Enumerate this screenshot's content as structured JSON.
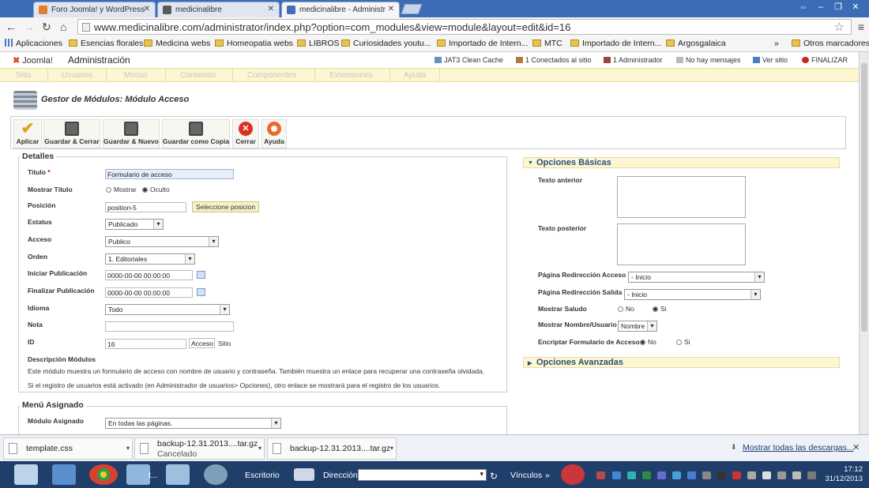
{
  "browser": {
    "tabs": [
      {
        "label": "Foro Joomla! y WordPress"
      },
      {
        "label": "medicinalibre"
      },
      {
        "label": "medicinalibre - Administr"
      }
    ],
    "url": "www.medicinalibre.com/administrator/index.php?option=com_modules&view=module&layout=edit&id=16",
    "bookmarks": [
      "Aplicaciones",
      "Esencias florales",
      "Medicina webs",
      "Homeopatia webs",
      "LIBROS",
      "Curiosidades youtu...",
      "Importado de Intern...",
      "MTC",
      "Importado de Intern...",
      "Argosgalaica"
    ],
    "bookmarks_overflow": "»",
    "other_bookmarks": "Otros marcadores"
  },
  "joomla": {
    "logo": "Joomla!",
    "admin_title": "Administración",
    "status": [
      "JAT3 Clean Cache",
      "1 Conectados al sitio",
      "1 Administrador",
      "No hay mensajes",
      "Ver sitio",
      "FINALIZAR"
    ],
    "menu": [
      "Sitio",
      "Usuarios",
      "Menús",
      "Contenido",
      "Componentes",
      "Extensiones",
      "Ayuda"
    ],
    "page_title": "Gestor de Módulos: Módulo Acceso",
    "toolbar": [
      "Aplicar",
      "Guardar & Cerrar",
      "Guardar & Nuevo",
      "Guardar como Copia",
      "Cerrar",
      "Ayuda"
    ],
    "details": {
      "legend": "Detalles",
      "titulo_label": "Titulo",
      "required_mark": "*",
      "titulo_value": "Formulario de acceso",
      "mostrar_titulo_label": "Mostrar Título",
      "mostrar": "Mostrar",
      "oculto": "Oculto",
      "posicion_label": "Posición",
      "posicion_value": "position-5",
      "posicion_button": "Seleccione posicion",
      "estatus_label": "Estatus",
      "estatus_value": "Publicado",
      "acceso_label": "Acceso",
      "acceso_value": "Publico",
      "orden_label": "Orden",
      "orden_value": "1. Editoriales",
      "iniciar_label": "Iniciar Publicación",
      "iniciar_value": "0000-00-00 00:00:00",
      "finalizar_label": "Finalizar Publicación",
      "finalizar_value": "0000-00-00 00:00:00",
      "idioma_label": "Idioma",
      "idioma_value": "Todo",
      "nota_label": "Nota",
      "nota_value": "",
      "id_label": "ID",
      "id_value": "16",
      "id_acceso": "Acceso",
      "id_sitio": "Sitio",
      "desc_label": "Descripción Módulos",
      "desc_1": "Este módulo muestra un formulario de acceso con nombre de usuario y contraseña. También muestra un enlace para recuperar una contraseña olvidada.",
      "desc_2": "Si el registro de usuarios está activado (en Administrador de usuarios> Opciones), otro enlace se mostrará para el registro de los usuarios."
    },
    "menu_assigned": {
      "legend": "Menú Asignado",
      "label": "Módulo Asignado",
      "value": "En todas las páginas."
    },
    "basic_options": {
      "title": "Opciones Básicas",
      "texto_anterior": "Texto anterior",
      "texto_posterior": "Texto posterior",
      "redir_acceso_label": "Página Redirección Acceso",
      "redir_acceso_value": "- Inicio",
      "redir_salida_label": "Página Redirección Salida",
      "redir_salida_value": "- Inicio",
      "saludo_label": "Mostrar Saludo",
      "no": "No",
      "si": "Si",
      "nombre_label": "Mostrar Nombre/Usuario",
      "nombre_value": "Nombre",
      "encriptar_label": "Encriptar Formulario de Acceso"
    },
    "advanced_options": {
      "title": "Opciones Avanzadas"
    }
  },
  "downloads": {
    "items": [
      {
        "name": "template.css",
        "status": ""
      },
      {
        "name": "backup-12.31.2013....tar.gz",
        "status": "Cancelado"
      },
      {
        "name": "backup-12.31.2013....tar.gz",
        "status": ""
      }
    ],
    "show_all": "Mostrar todas las descargas..."
  },
  "taskbar": {
    "escritorio": "Escritorio",
    "direccion": "Dirección",
    "vinculos": "Vínculos",
    "time": "17:12",
    "date": "31/12/2013"
  }
}
